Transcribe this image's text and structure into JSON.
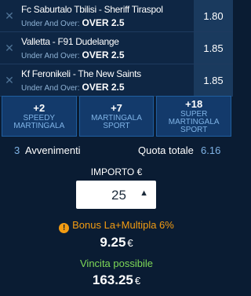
{
  "bets": [
    {
      "match": "Fc Saburtalo Tbilisi - Sheriff Tiraspol",
      "market": "Under And Over:",
      "selection": "OVER 2.5",
      "odd": "1.80"
    },
    {
      "match": "Valletta - F91 Dudelange",
      "market": "Under And Over:",
      "selection": "OVER 2.5",
      "odd": "1.85"
    },
    {
      "match": "Kf Feronikeli - The New Saints",
      "market": "Under And Over:",
      "selection": "OVER 2.5",
      "odd": "1.85"
    }
  ],
  "bonus_options": [
    {
      "plus": "+2",
      "name_1": "SPEEDY",
      "name_2": "MARTINGALA"
    },
    {
      "plus": "+7",
      "name_1": "MARTINGALA",
      "name_2": "SPORT"
    },
    {
      "plus": "+18",
      "name_1": "SUPER",
      "name_2": "MARTINGALA",
      "name_3": "SPORT"
    }
  ],
  "summary": {
    "count": "3",
    "events_label": "Avvenimenti",
    "total_odd_label": "Quota totale",
    "total_odd": "6.16"
  },
  "stake": {
    "label": "IMPORTO €",
    "value": "25"
  },
  "bonus": {
    "label": "Bonus La+Multipla 6%",
    "amount": "9.25",
    "currency": "€"
  },
  "winning": {
    "label": "Vincita possibile",
    "amount": "163.25",
    "currency": "€"
  },
  "colors": {
    "background": "#0a1c33",
    "accent": "#7fb3e6",
    "bonus": "#f39c12",
    "win": "#7ed957"
  }
}
